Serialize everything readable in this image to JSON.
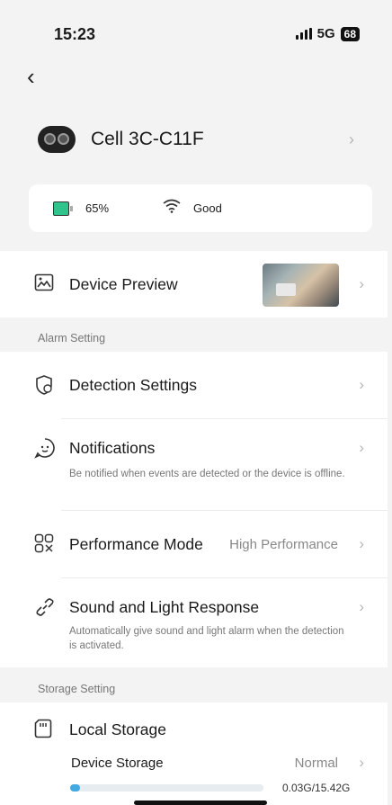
{
  "status_bar": {
    "time": "15:23",
    "network": "5G",
    "battery": "68"
  },
  "device": {
    "name": "Cell 3C-C11F"
  },
  "status_card": {
    "battery_pct": "65%",
    "wifi_label": "Good"
  },
  "preview": {
    "label": "Device Preview"
  },
  "alarm_group_label": "Alarm Setting",
  "detection": {
    "label": "Detection Settings"
  },
  "notifications": {
    "label": "Notifications",
    "desc": "Be notified when events are detected or the device is offline."
  },
  "performance": {
    "label": "Performance Mode",
    "value": "High Performance"
  },
  "sound_light": {
    "label": "Sound and Light Response",
    "desc": "Automatically give sound and light alarm when the detection is activated."
  },
  "storage_group_label": "Storage Setting",
  "local_storage": {
    "label": "Local Storage"
  },
  "device_storage": {
    "label": "Device Storage",
    "status": "Normal",
    "usage": "0.03G/15.42G",
    "used_fraction": 0.02
  },
  "icons": {
    "back": "chevron-left-icon",
    "chevron": "chevron-right-icon",
    "wifi": "wifi-icon",
    "battery": "battery-icon"
  },
  "colors": {
    "accent": "#44a9e0",
    "battery_green": "#2fc48c"
  }
}
